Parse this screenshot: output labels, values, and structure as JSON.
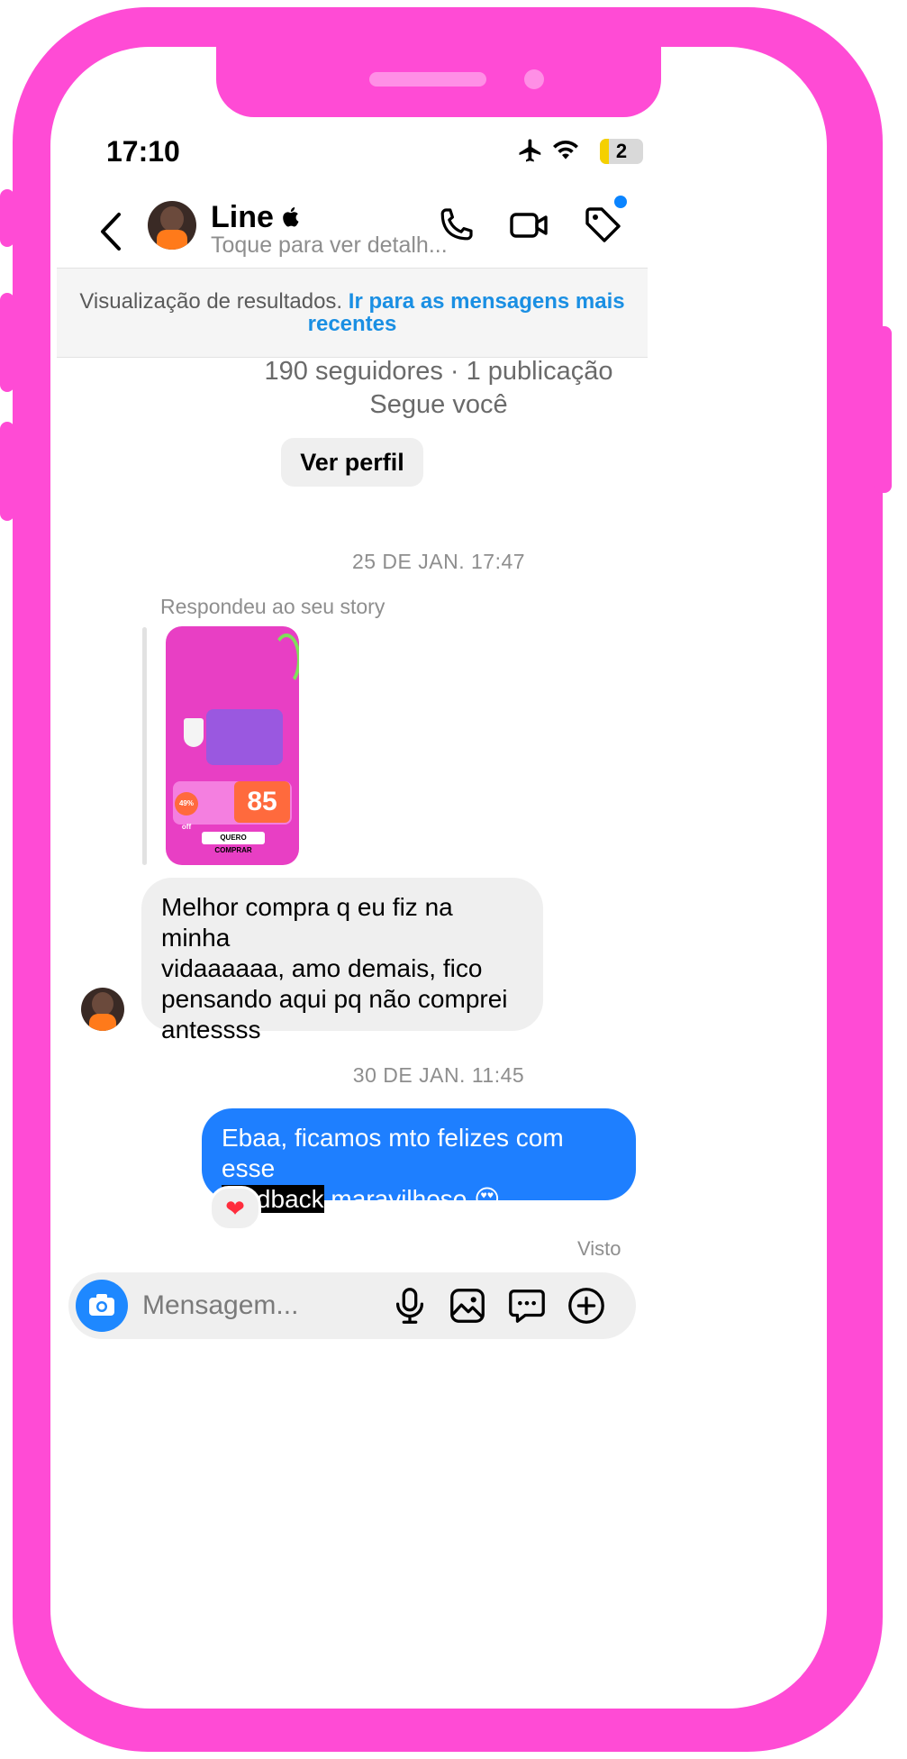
{
  "status_bar": {
    "time": "17:10",
    "battery": "2"
  },
  "header": {
    "contact_name": "Line",
    "subtitle": "Toque para ver detalh..."
  },
  "banner": {
    "text": "Visualização de resultados.",
    "link_line1": "Ir para as mensagens mais",
    "link_line2": "recentes"
  },
  "profile": {
    "stats": "190 seguidores · 1 publicação",
    "follows": "Segue você",
    "view_profile_button": "Ver perfil"
  },
  "messages": {
    "date1": "25 DE JAN. 17:47",
    "story_reply_label": "Respondeu ao seu story",
    "story": {
      "discount": "49% off",
      "price": "85",
      "cta": "QUERO COMPRAR"
    },
    "incoming": {
      "line1": "Melhor compra q eu fiz na minha",
      "line2": "vidaaaaaa, amo demais, fico",
      "line3": "pensando aqui pq não comprei",
      "line4": "antessss"
    },
    "date2": "30 DE JAN. 11:45",
    "outgoing": {
      "line1": "Ebaa, ficamos mto felizes com esse",
      "highlighted_word": "feedback",
      "line2_rest": "maravilhoso 😍"
    },
    "reaction": "❤",
    "seen": "Visto"
  },
  "composer": {
    "placeholder": "Mensagem..."
  },
  "colors": {
    "phone_frame": "#ff4bd5",
    "outgoing_bubble": "#1e7fff",
    "incoming_bubble": "#efefef",
    "link": "#1a8fe3"
  }
}
